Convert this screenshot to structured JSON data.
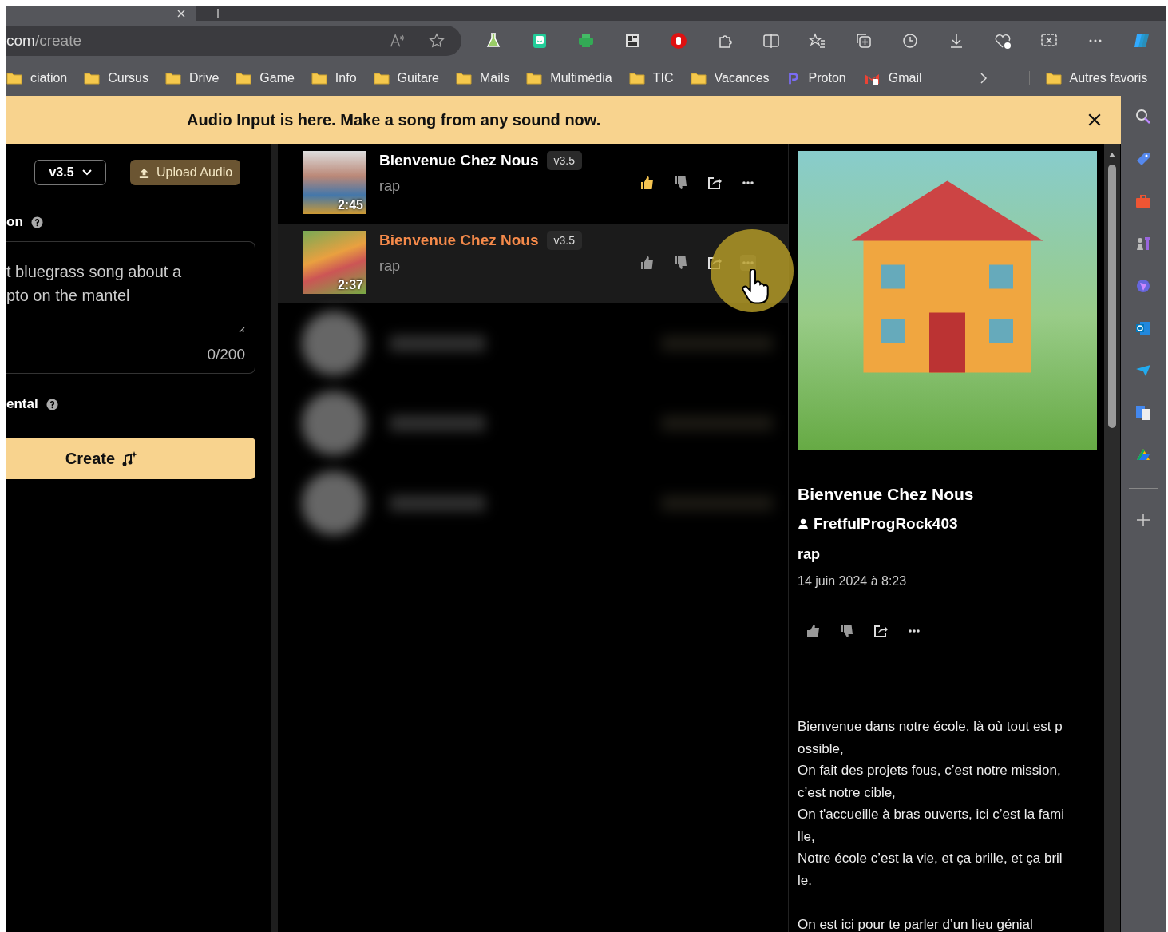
{
  "browser": {
    "address": {
      "host": "com",
      "path": "/create"
    },
    "bookmarks": [
      {
        "kind": "folder",
        "label": "ciation"
      },
      {
        "kind": "folder",
        "label": "Cursus"
      },
      {
        "kind": "folder",
        "label": "Drive"
      },
      {
        "kind": "folder",
        "label": "Game"
      },
      {
        "kind": "folder",
        "label": "Info"
      },
      {
        "kind": "folder",
        "label": "Guitare"
      },
      {
        "kind": "folder",
        "label": "Mails"
      },
      {
        "kind": "folder",
        "label": "Multimédia"
      },
      {
        "kind": "folder",
        "label": "TIC"
      },
      {
        "kind": "folder",
        "label": "Vacances"
      },
      {
        "kind": "proton",
        "label": "Proton"
      },
      {
        "kind": "gmail",
        "label": "Gmail"
      }
    ],
    "other_bookmarks": "Autres favoris"
  },
  "banner": {
    "text": "Audio Input is here. Make a song from any sound now."
  },
  "create_panel": {
    "model": "v3.5",
    "upload_button": "Upload Audio",
    "prompt_label": "on",
    "prompt_value": "t bluegrass song about a\npto on the mantel",
    "counter": "0/200",
    "instrumental_label": "ental",
    "create_button": "Create"
  },
  "songs": [
    {
      "title": "Bienvenue Chez Nous",
      "version": "v3.5",
      "genre": "rap",
      "duration": "2:45",
      "selected": false,
      "liked": true
    },
    {
      "title": "Bienvenue Chez Nous",
      "version": "v3.5",
      "genre": "rap",
      "duration": "2:37",
      "selected": true,
      "liked": false
    }
  ],
  "detail": {
    "title": "Bienvenue Chez Nous",
    "author": "FretfulProgRock403",
    "genre": "rap",
    "date": "14 juin 2024 à 8:23",
    "lyrics": [
      [
        "Bienvenue dans notre école, là où tout est p",
        "ossible,",
        "On fait des projets fous, c’est notre mission,",
        "c’est notre cible,",
        "On t'accueille à bras ouverts, ici c’est la fami",
        "lle,",
        "Notre école c’est la vie, et ça brille, et ça bril",
        "le."
      ],
      [
        "On est ici pour te parler d’un lieu génial"
      ]
    ]
  }
}
